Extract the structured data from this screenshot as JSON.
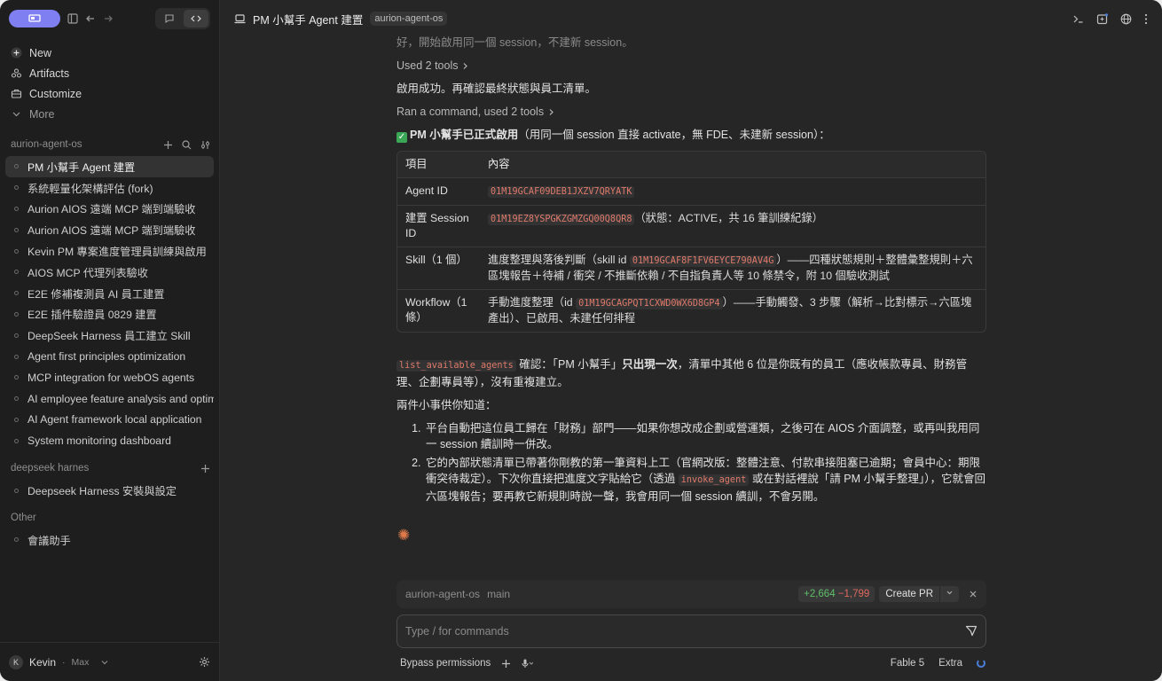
{
  "sidebar": {
    "menu": [
      {
        "label": "New",
        "icon": "plus-icon"
      },
      {
        "label": "Artifacts",
        "icon": "artifacts-icon"
      },
      {
        "label": "Customize",
        "icon": "briefcase-icon"
      },
      {
        "label": "More",
        "icon": "chevron-down-icon"
      }
    ],
    "sections": [
      {
        "title": "aurion-agent-os",
        "items": [
          "PM 小幫手 Agent 建置",
          "系統輕量化架構評估 (fork)",
          "Aurion AIOS 遠端 MCP 端到端驗收",
          "Aurion AIOS 遠端 MCP 端到端驗收",
          "Kevin PM 專案進度管理員訓練與啟用",
          "AIOS MCP 代理列表驗收",
          "E2E 修補複測員 AI 員工建置",
          "E2E 插件驗證員 0829 建置",
          "DeepSeek Harness 員工建立 Skill",
          "Agent first principles optimization",
          "MCP integration for webOS agents",
          "AI employee feature analysis and optim",
          "AI Agent framework local application",
          "System monitoring dashboard"
        ]
      },
      {
        "title": "deepseek harnes",
        "items": [
          "Deepseek Harness 安裝與設定"
        ]
      },
      {
        "title": "Other",
        "items": [
          "會議助手"
        ]
      }
    ],
    "user": {
      "initial": "K",
      "name": "Kevin",
      "plan": "Max"
    }
  },
  "header": {
    "title": "PM 小幫手 Agent 建置",
    "tag": "aurion-agent-os"
  },
  "chat": {
    "line1": "好，開始啟用同一個 session，不建新 session。",
    "tools1": "Used 2 tools",
    "line2": "啟用成功。再確認最終狀態與員工清單。",
    "tools2": "Ran a command, used 2 tools",
    "success_bold": "PM 小幫手已正式啟用",
    "success_rest": "（用同一個 session 直接 activate，無 FDE、未建新 session）：",
    "table": {
      "headers": [
        "項目",
        "內容"
      ],
      "rows": [
        {
          "key": "Agent ID",
          "code": "01M19GCAF09DEB1JXZV7QRYATK",
          "pre": "",
          "post": ""
        },
        {
          "key": "建置 Session ID",
          "code": "01M19EZ8YSPGKZGMZGQ00Q8QR8",
          "pre": "",
          "post": "（狀態：ACTIVE，共 16 筆訓練紀錄）"
        },
        {
          "key": "Skill（1 個）",
          "code": "01M19GCAF8F1FV6EYCE790AV4G",
          "pre": "進度整理與落後判斷（skill id ",
          "post": "）——四種狀態規則＋整體彙整規則＋六區塊報告＋待補 / 衝突 / 不推斷依賴 / 不自指負責人等 10 條禁令，附 10 個驗收測試"
        },
        {
          "key": "Workflow（1 條）",
          "code": "01M19GCAGPQT1CXWD0WX6D8GP4",
          "pre": "手動進度整理（id ",
          "post": "）——手動觸發、3 步驟（解析→比對標示→六區塊產出）、已啟用、未建任何排程"
        }
      ]
    },
    "confirm_code": "list_available_agents",
    "confirm_a": " 確認：「PM 小幫手」",
    "confirm_bold": "只出現一次",
    "confirm_b": "，清單中其他 6 位是你既有的員工（應收帳款專員、財務管理、企劃專員等），沒有重複建立。",
    "notes_title": "兩件小事供你知道：",
    "note1": "平台自動把這位員工歸在「財務」部門——如果你想改成企劃或營運類，之後可在 AIOS 介面調整，或再叫我用同一 session 續訓時一併改。",
    "note2_a": "它的內部狀態清單已帶著你剛教的第一筆資料上工（官網改版：整體注意、付款串接阻塞已逾期；會員中心：期限衝突待裁定）。下次你直接把進度文字貼給它（透過 ",
    "note2_code": "invoke_agent",
    "note2_b": " 或在對話裡說「請 PM 小幫手整理」），它就會回六區塊報告；要再教它新規則時說一聲，我會用同一個 session 續訓，不會另開。"
  },
  "status": {
    "repo": "aurion-agent-os",
    "branch": "main",
    "added": "+2,664",
    "removed": "−1,799",
    "pr_label": "Create PR"
  },
  "composer": {
    "placeholder": "Type / for commands"
  },
  "footer": {
    "permissions": "Bypass permissions",
    "model": "Fable 5",
    "effort": "Extra"
  },
  "colors": {
    "accent": "#7f7ff2",
    "code": "#e07a6b",
    "added": "#5fbf6a",
    "removed": "#e0685e"
  }
}
